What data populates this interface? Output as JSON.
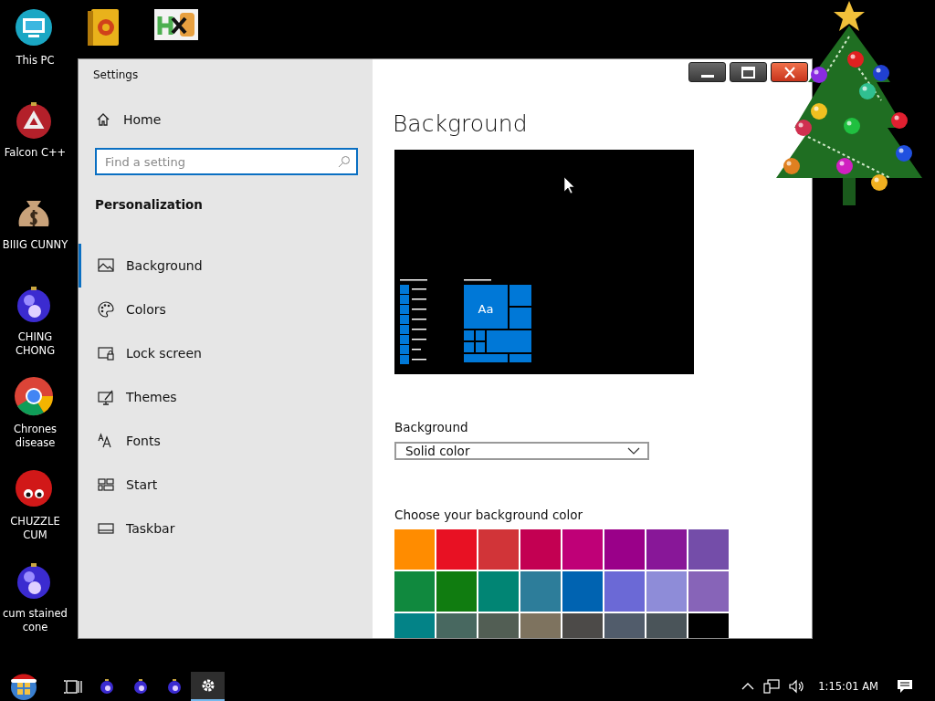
{
  "desktop_icons": [
    {
      "label": "This PC",
      "kind": "pc"
    },
    {
      "kind": "book"
    },
    {
      "kind": "hxd"
    },
    {
      "label": "Falcon C++",
      "kind": "recycle"
    },
    {
      "label": "BIIIG CUNNY",
      "kind": "bag"
    },
    {
      "label": "CHING CHONG",
      "kind": "ornament"
    },
    {
      "label": "Chrones disease",
      "kind": "browser"
    },
    {
      "label": "CHUZZLE CUM",
      "kind": "fuzzball"
    },
    {
      "label": "cum stained cone",
      "kind": "ornament"
    }
  ],
  "window": {
    "title": "Settings",
    "controls": [
      {
        "kind": "minimize"
      },
      {
        "kind": "maximize"
      },
      {
        "kind": "close"
      }
    ]
  },
  "sidebar": {
    "home": "Home",
    "search": {
      "placeholder": "Find a setting"
    },
    "section": "Personalization",
    "items": [
      {
        "label": "Background",
        "kind": "picture",
        "selected": true
      },
      {
        "label": "Colors",
        "kind": "palette",
        "selected": false
      },
      {
        "label": "Lock screen",
        "kind": "lock",
        "selected": false
      },
      {
        "label": "Themes",
        "kind": "themes",
        "selected": false
      },
      {
        "label": "Fonts",
        "kind": "fonts",
        "selected": false
      },
      {
        "label": "Start",
        "kind": "start",
        "selected": false
      },
      {
        "label": "Taskbar",
        "kind": "taskbar",
        "selected": false
      }
    ]
  },
  "content": {
    "heading": "Background",
    "preview": {
      "tile_label": "Aa"
    },
    "background_label": "Background",
    "background_value": "Solid color",
    "colors_label": "Choose your background color",
    "swatches": [
      {
        "color": "#ff8c00"
      },
      {
        "color": "#e81123"
      },
      {
        "color": "#d13438"
      },
      {
        "color": "#c30052"
      },
      {
        "color": "#bf0077"
      },
      {
        "color": "#9a0089"
      },
      {
        "color": "#881798"
      },
      {
        "color": "#744da9"
      },
      {
        "color": "#10893e"
      },
      {
        "color": "#107c10"
      },
      {
        "color": "#018574"
      },
      {
        "color": "#2d7d9a"
      },
      {
        "color": "#0063b1"
      },
      {
        "color": "#6b69d6"
      },
      {
        "color": "#8e8cd8"
      },
      {
        "color": "#8764b8"
      },
      {
        "color": "#038387"
      },
      {
        "color": "#486860"
      },
      {
        "color": "#525e54"
      },
      {
        "color": "#7e735f"
      },
      {
        "color": "#4c4a48"
      },
      {
        "color": "#515c6b"
      },
      {
        "color": "#4a5459"
      },
      {
        "color": "#000000"
      }
    ]
  },
  "taskbar": {
    "items": [
      {
        "kind": "taskview",
        "selected": false
      },
      {
        "kind": "ornament",
        "selected": false
      },
      {
        "kind": "ornament",
        "selected": false
      },
      {
        "kind": "ornament",
        "selected": false
      },
      {
        "kind": "settings",
        "selected": true
      }
    ],
    "clock": "1:15:01 AM"
  }
}
